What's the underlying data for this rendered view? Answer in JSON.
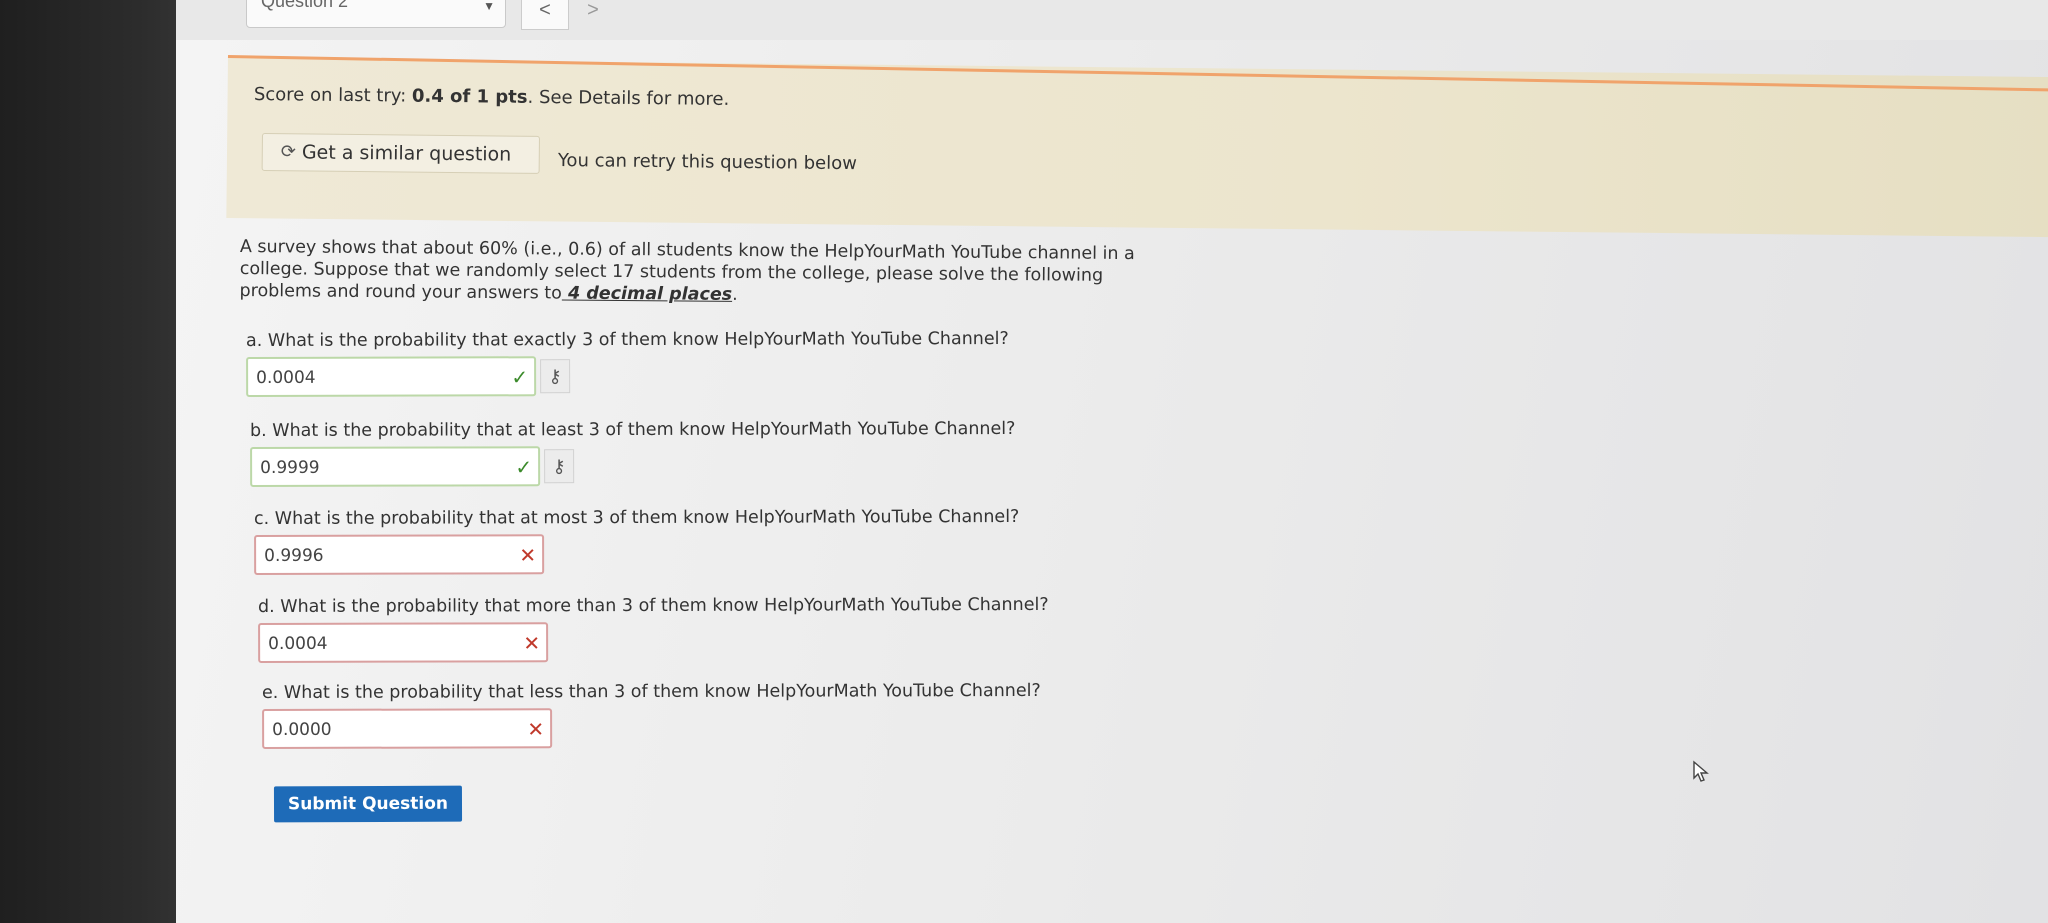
{
  "header": {
    "question_select": "Question 2",
    "prev_button": "<",
    "next_button": ">"
  },
  "score": {
    "prefix": "Score on last try: ",
    "value": "0.4 of 1 pts",
    "suffix": ". See Details for more."
  },
  "retry": {
    "similar_button": "Get a similar question",
    "retry_text": "You can retry this question below"
  },
  "problem": {
    "text_before": "A survey shows that about 60% (i.e., 0.6) of all students know the HelpYourMath YouTube channel in a college. Suppose that we randomly select 17 students from the college, please solve the following problems and round your answers to",
    "emphasis": " 4 decimal places",
    "text_after": "."
  },
  "parts": [
    {
      "question": "a. What is the probability that exactly 3 of them know HelpYourMath YouTube Channel?",
      "answer": "0.0004",
      "status": "correct"
    },
    {
      "question": "b. What is the probability that at least 3 of them know HelpYourMath YouTube Channel?",
      "answer": "0.9999",
      "status": "correct"
    },
    {
      "question": "c. What is the probability that at most 3 of them know HelpYourMath YouTube Channel?",
      "answer": "0.9996",
      "status": "wrong"
    },
    {
      "question": "d. What is the probability that more than 3 of them know HelpYourMath YouTube Channel?",
      "answer": "0.0004",
      "status": "wrong"
    },
    {
      "question": "e. What is the probability that less than 3 of them know HelpYourMath YouTube Channel?",
      "answer": "0.0000",
      "status": "wrong"
    }
  ],
  "icons": {
    "check": "✓",
    "cross": "✕",
    "key": "⚷",
    "refresh": "⟳"
  },
  "submit_label": "Submit Question",
  "colors": {
    "accent": "#1e6bb8",
    "score_panel": "#ece5cd",
    "correct": "#3a8a2a",
    "wrong": "#c0392b"
  }
}
